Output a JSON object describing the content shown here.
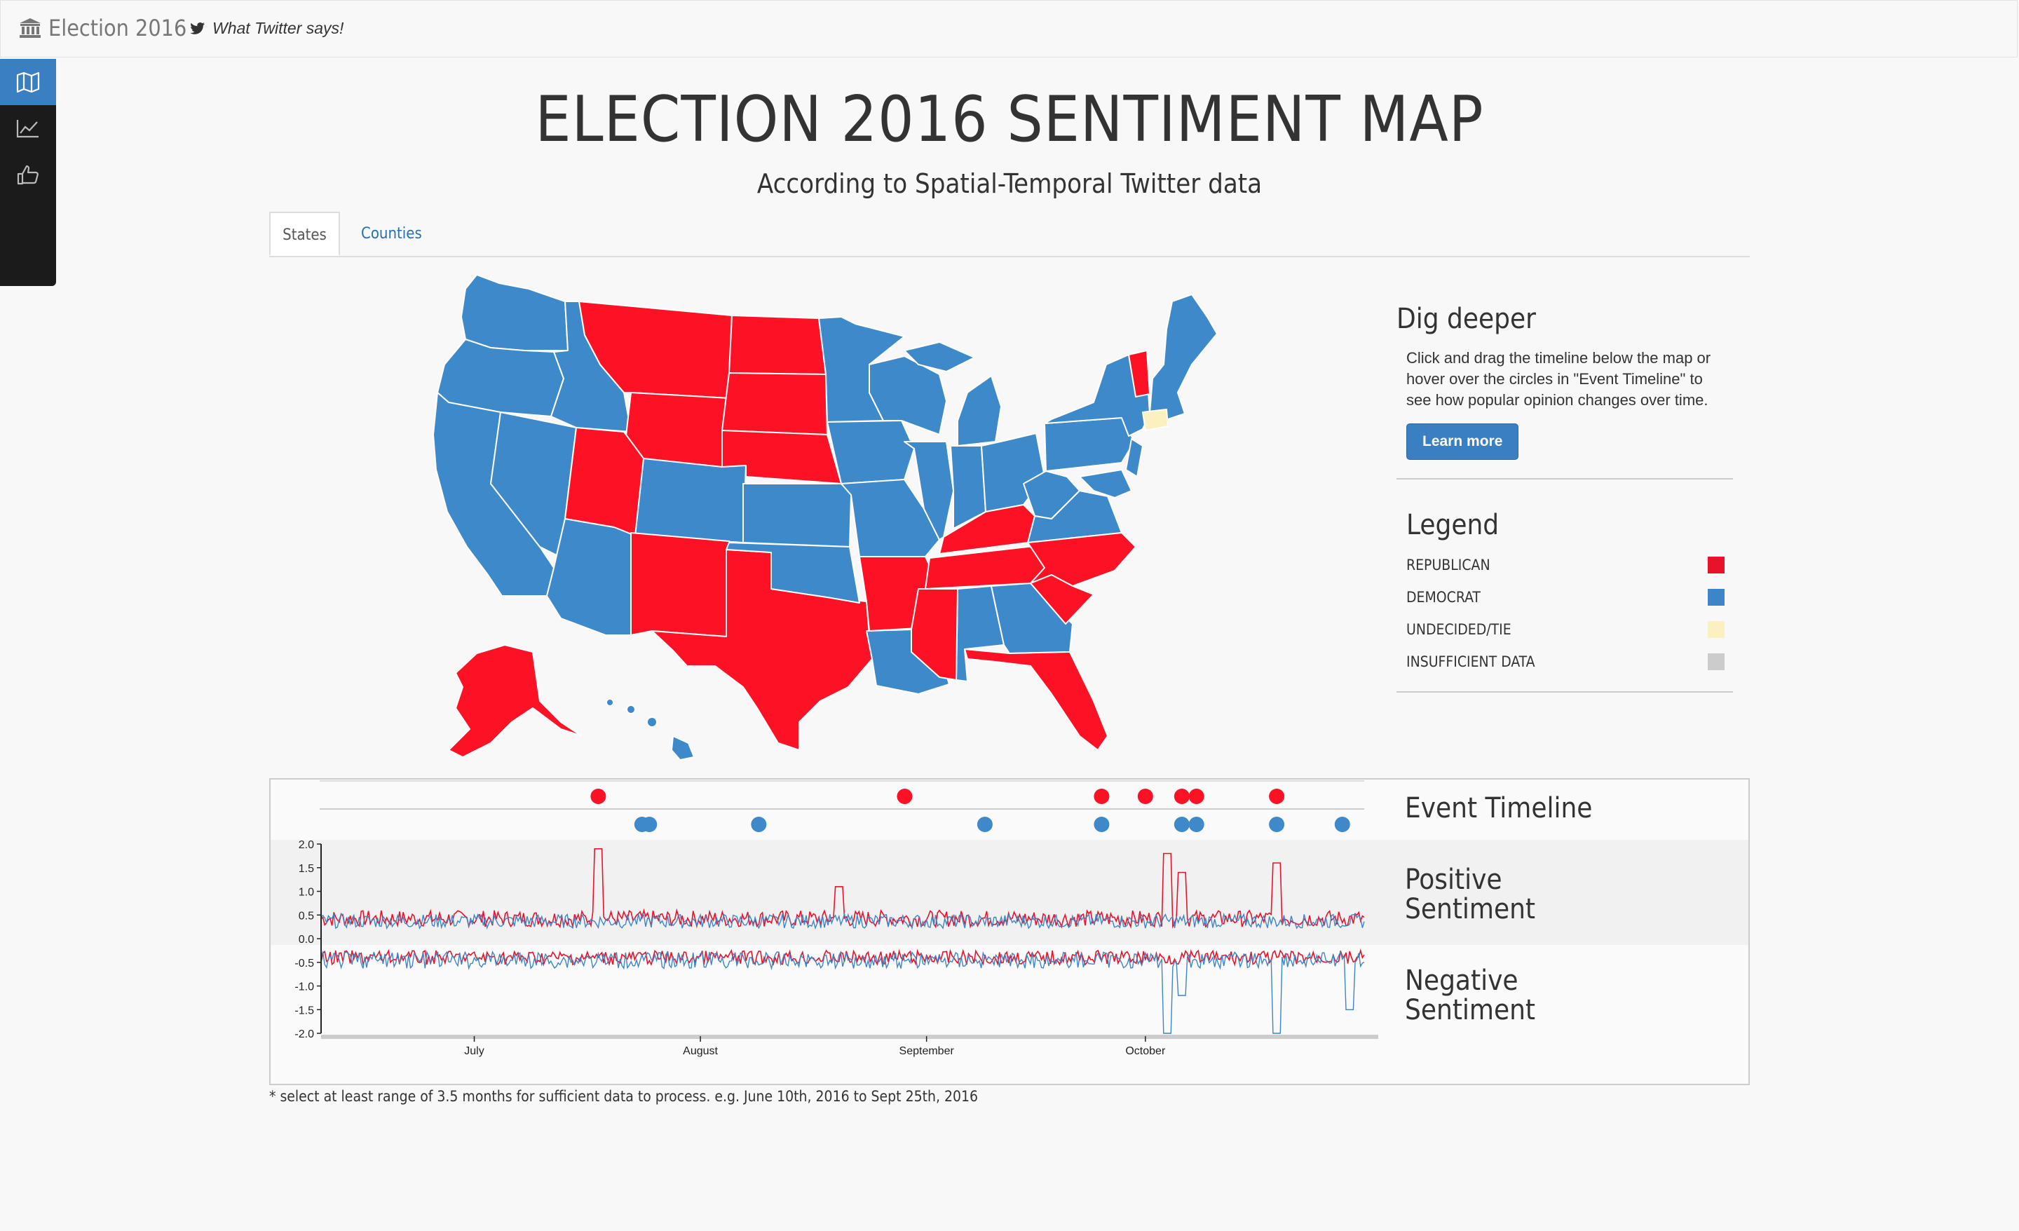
{
  "navbar": {
    "brand": "Election 2016",
    "twitter_link": "What Twitter says!"
  },
  "sidebar": {
    "items": [
      {
        "icon": "map-icon",
        "active": true
      },
      {
        "icon": "line-chart-icon",
        "active": false
      },
      {
        "icon": "thumbs-up-icon",
        "active": false
      }
    ]
  },
  "page": {
    "title": "ELECTION 2016 SENTIMENT MAP",
    "subtitle": "According to Spatial-Temporal Twitter data"
  },
  "tabs": [
    {
      "label": "States",
      "active": true
    },
    {
      "label": "Counties",
      "active": false
    }
  ],
  "dig_deeper": {
    "title": "Dig deeper",
    "text": "Click and drag the timeline below the map or hover over the circles in \"Event Timeline\" to see how popular opinion changes over time.",
    "button": "Learn more"
  },
  "legend": {
    "title": "Legend",
    "items": [
      {
        "label": "REPUBLICAN",
        "color": "#e8132b"
      },
      {
        "label": "DEMOCRAT",
        "color": "#3d85c6"
      },
      {
        "label": "UNDECIDED/TIE",
        "color": "#fbf0c0"
      },
      {
        "label": "INSUFFICIENT DATA",
        "color": "#cccccc"
      }
    ]
  },
  "colors": {
    "republican": "#fd1124",
    "democrat": "#3d89c9",
    "undecided": "#fbf0c0"
  },
  "timeline": {
    "event_label": "Event Timeline",
    "positive_label": "Positive Sentiment",
    "negative_label": "Negative Sentiment",
    "note": "* select at least range of 3.5 months for sufficient data to process. e.g. June 10th, 2016 to Sept 25th, 2016"
  },
  "chart_data": {
    "type": "line",
    "x_tick_labels": [
      "July",
      "August",
      "September",
      "October"
    ],
    "y_tick_labels": [
      "2.0",
      "1.5",
      "1.0",
      "0.5",
      "0.0",
      "-0.5",
      "-1.0",
      "-1.5",
      "-2.0"
    ],
    "ylim": [
      -2.0,
      2.0
    ],
    "xlim": [
      "2016-06-10",
      "2016-10-31"
    ],
    "republican_events": [
      "2016-07-18",
      "2016-08-29",
      "2016-09-25",
      "2016-10-01",
      "2016-10-06",
      "2016-10-08",
      "2016-10-19"
    ],
    "democrat_events": [
      "2016-07-24",
      "2016-07-25",
      "2016-08-09",
      "2016-09-09",
      "2016-09-25",
      "2016-10-06",
      "2016-10-08",
      "2016-10-19",
      "2016-10-28"
    ],
    "series": [
      {
        "color": "#e8132b",
        "spikes": [
          [
            "2016-07-18",
            1.9
          ],
          [
            "2016-08-20",
            1.1
          ],
          [
            "2016-10-04",
            1.8
          ],
          [
            "2016-10-06",
            1.4
          ],
          [
            "2016-10-19",
            1.6
          ]
        ]
      },
      {
        "color": "#3d85c6",
        "spikes": [
          [
            "2016-10-04",
            -2.0
          ],
          [
            "2016-10-06",
            -1.2
          ],
          [
            "2016-10-19",
            -2.0
          ],
          [
            "2016-10-29",
            -1.5
          ]
        ]
      }
    ]
  }
}
